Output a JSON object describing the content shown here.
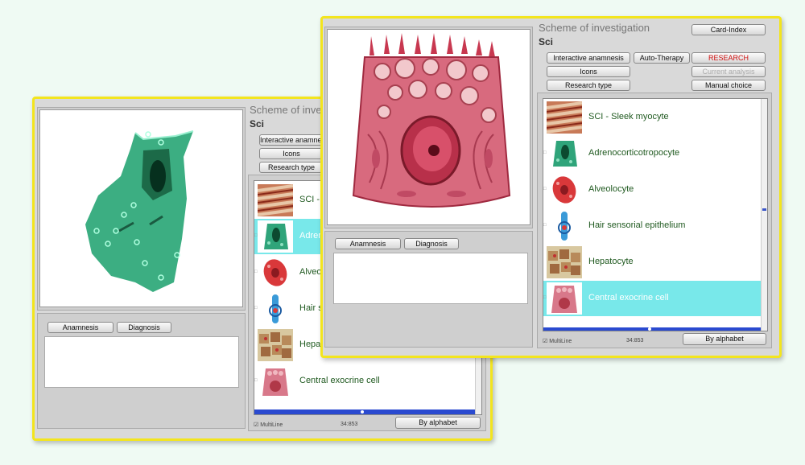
{
  "colors": {
    "page_bg": "#effaf3",
    "window_frame": "#f3e51d",
    "selection": "#78e8ea",
    "item_text": "#205a20",
    "research_text": "#d01010",
    "scroll_blue": "#2a4ad0"
  },
  "back_window": {
    "title": "Scheme of invest",
    "subtitle": "Sci",
    "buttons": {
      "interactive_anamnesis": "Interactive anamnesis",
      "icons": "Icons",
      "research_type": "Research type"
    },
    "tabs": {
      "anamnesis": "Anamnesis",
      "diagnosis": "Diagnosis"
    },
    "list": [
      {
        "label": "SCI - ",
        "icon": "myocyte-icon",
        "selected": false
      },
      {
        "label": "Adren",
        "icon": "adrenocyte-icon",
        "selected": true
      },
      {
        "label": "Alveol",
        "icon": "alveolocyte-icon",
        "selected": false
      },
      {
        "label": "Hair s",
        "icon": "hair-cell-icon",
        "selected": false
      },
      {
        "label": "Hepat",
        "icon": "hepatocyte-icon",
        "selected": false
      },
      {
        "label": "Central exocrine cell",
        "icon": "exocrine-cell-icon",
        "selected": false
      }
    ],
    "status": {
      "multiline": "☑ MultiLine",
      "time": "34:853"
    },
    "by_alphabet": "By alphabet",
    "preview_icon": "green-cell-icon"
  },
  "front_window": {
    "title": "Scheme of investigation",
    "subtitle": "Sci",
    "buttons": {
      "card_index": "Card-Index",
      "interactive_anamnesis": "Interactive anamnesis",
      "auto_therapy": "Auto-Therapy",
      "research": "RESEARCH",
      "icons": "Icons",
      "current_analysis": "Current analysis",
      "research_type": "Research type",
      "manual_choice": "Manual choice"
    },
    "tabs": {
      "anamnesis": "Anamnesis",
      "diagnosis": "Diagnosis"
    },
    "list": [
      {
        "label": "SCI - Sleek myocyte",
        "icon": "myocyte-icon",
        "selected": false
      },
      {
        "label": "Adrenocorticotropocyte",
        "icon": "adrenocyte-icon",
        "selected": false
      },
      {
        "label": "Alveolocyte",
        "icon": "alveolocyte-icon",
        "selected": false
      },
      {
        "label": "Hair sensorial epithelium",
        "icon": "hair-cell-icon",
        "selected": false
      },
      {
        "label": "Hepatocyte",
        "icon": "hepatocyte-icon",
        "selected": false
      },
      {
        "label": "Central exocrine cell",
        "icon": "exocrine-cell-icon",
        "selected": true
      }
    ],
    "status": {
      "multiline": "☑ MultiLine",
      "time": "34:853"
    },
    "by_alphabet": "By alphabet",
    "preview_icon": "exocrine-cell-large-icon"
  }
}
